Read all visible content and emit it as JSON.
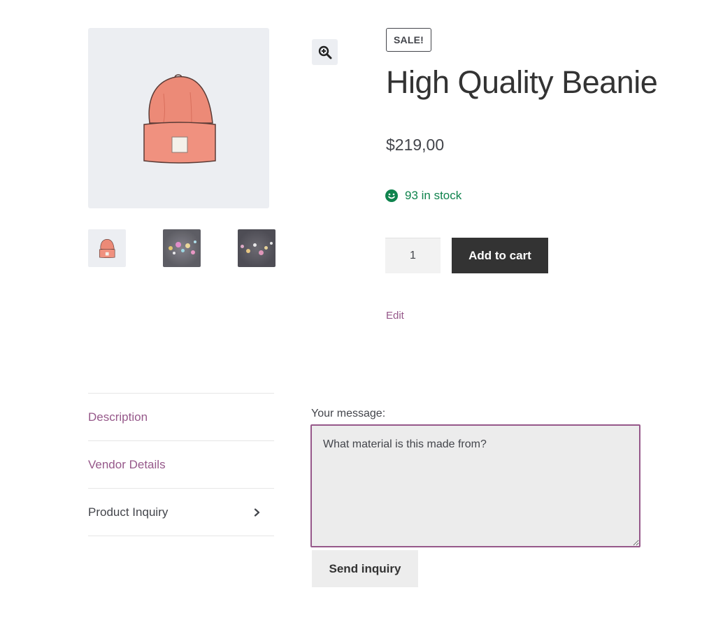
{
  "gallery": {
    "main_image_icon": "beanie-image",
    "zoom_icon": "zoom-in-icon",
    "thumbnails": [
      "beanie-thumbnail",
      "bokeh-lights-thumbnail",
      "bokeh-lights-thumbnail-2"
    ]
  },
  "product": {
    "badge": "SALE!",
    "title": "High Quality Beanie",
    "price": "$219,00",
    "stock": "93 in stock",
    "quantity": "1",
    "add_to_cart": "Add to cart",
    "edit": "Edit"
  },
  "tabs": [
    {
      "label": "Description"
    },
    {
      "label": "Vendor Details"
    },
    {
      "label": "Product Inquiry"
    }
  ],
  "inquiry": {
    "label": "Your message:",
    "message": "What material is this made from?",
    "send": "Send inquiry"
  },
  "colors": {
    "accent": "#96588a",
    "stock": "#0f834d",
    "button_dark": "#333333",
    "image_bg": "#eceef2"
  }
}
